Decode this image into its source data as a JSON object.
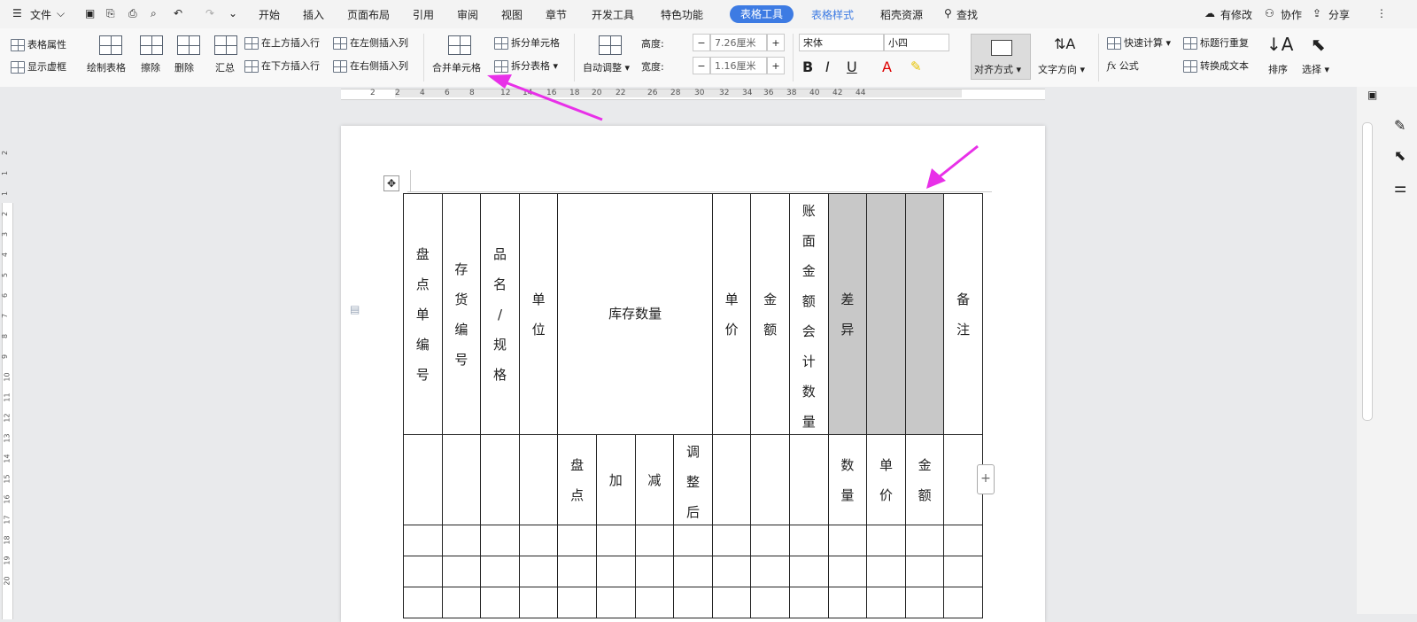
{
  "menubar": {
    "file": "文件",
    "tabs": [
      "开始",
      "插入",
      "页面布局",
      "引用",
      "审阅",
      "视图",
      "章节",
      "开发工具",
      "特色功能"
    ],
    "table_tools": "表格工具",
    "table_style": "表格样式",
    "straw": "稻壳资源",
    "search": "查找",
    "modified": "有修改",
    "collab": "协作",
    "share": "分享"
  },
  "ribbon": {
    "table_props": "表格属性",
    "show_grid": "显示虚框",
    "draw_table": "绘制表格",
    "erase": "擦除",
    "delete": "删除",
    "summary": "汇总",
    "insert_above": "在上方插入行",
    "insert_below": "在下方插入行",
    "insert_left": "在左侧插入列",
    "insert_right": "在右侧插入列",
    "merge_cells": "合并单元格",
    "split_cells": "拆分单元格",
    "split_table": "拆分表格",
    "auto_adjust": "自动调整",
    "height_label": "高度:",
    "height_value": "7.26厘米",
    "width_label": "宽度:",
    "width_value": "1.16厘米",
    "font_name": "宋体",
    "font_size": "小四",
    "bold": "B",
    "italic": "I",
    "underline": "U",
    "font_color": "A",
    "align": "对齐方式",
    "text_dir": "文字方向",
    "quick_calc": "快速计算",
    "formula": "公式",
    "title_repeat": "标题行重复",
    "to_text": "转换成文本",
    "sort": "排序",
    "select": "选择"
  },
  "ruler_numbers": [
    "2",
    "2",
    "4",
    "6",
    "8",
    "12",
    "14",
    "16",
    "18",
    "20",
    "22",
    "26",
    "28",
    "30",
    "32",
    "34",
    "36",
    "38",
    "40",
    "42",
    "44"
  ],
  "vruler_numbers": [
    "2",
    "1",
    "1",
    "2",
    "3",
    "4",
    "5",
    "6",
    "7",
    "8",
    "9",
    "10",
    "11",
    "12",
    "13",
    "14",
    "15",
    "16",
    "17",
    "18",
    "19",
    "20"
  ],
  "table": {
    "header1": [
      "盘点单编号",
      "存货编号",
      "品名/规格",
      "单位",
      "库存数量",
      "单价",
      "金额",
      "账面金额会计数量",
      "差异",
      "",
      "",
      "备注"
    ],
    "sub": [
      "盘点",
      "加",
      "减",
      "调整后"
    ],
    "diff_sub": [
      "数量",
      "单价",
      "金额"
    ]
  },
  "colors": {
    "accent": "#3d7be3",
    "arrow": "#e830e8",
    "gray_cell": "#c8c8c8"
  }
}
